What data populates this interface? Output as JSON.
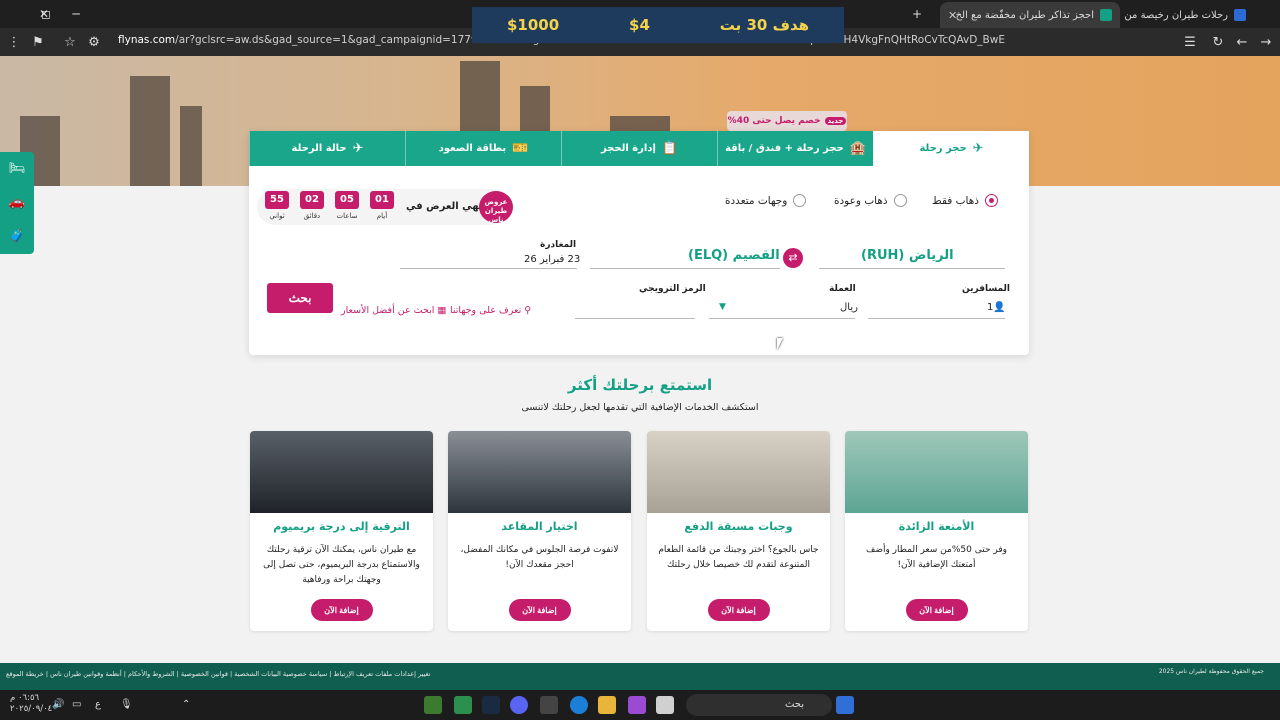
{
  "browser": {
    "tabs": [
      {
        "title": "رحلات طيران رخيصة من الرياض",
        "fav_color": "#2d6bd4",
        "close": "✕"
      },
      {
        "title": "احجز تذاكر طيران مخفّضة مع الخ",
        "fav_color": "#14a085",
        "close": "✕"
      }
    ],
    "new_tab": "+",
    "window_controls": {
      "minimize": "─",
      "maximize": "◻",
      "close": "✕"
    },
    "url_domain": "flynas.com",
    "url_rest": "/ar?gclsrc=aw.ds&gad_source=1&gad_campaignid=17793646925&gbraid=...Woh0XhOeVuPuwC6E2BF7tbGLUWfXRkLMqfGCcsH4VkgFnQHtRoCvTcQAvD_BwE",
    "overlay_ad": {
      "left": "$1000",
      "middle": "$4",
      "right": "هدف 30 بت"
    }
  },
  "promo_badge": {
    "tag": "جديد",
    "text": "خصم يصل حتى 40%"
  },
  "side_tools": [
    "🛏",
    "🚗",
    "🧳"
  ],
  "tabs": [
    {
      "label": "حجز رحلة",
      "icon": "✈"
    },
    {
      "label": "حجز رحلة + فندق / باقة",
      "icon": "🏨"
    },
    {
      "label": "إدارة الحجز",
      "icon": "📋"
    },
    {
      "label": "بطاقة الصعود",
      "icon": "🎫"
    },
    {
      "label": "حالة الرحلة",
      "icon": "✈"
    }
  ],
  "trip_type": {
    "one_way": "ذهاب فقط",
    "round_trip": "ذهاب وعودة",
    "multi_city": "وجهات متعددة"
  },
  "timer": {
    "label": "ينتهي العرض في",
    "badge": "عروض طيران ناس",
    "days": {
      "value": "01",
      "label": "أيام"
    },
    "hours": {
      "value": "05",
      "label": "ساعات"
    },
    "minutes": {
      "value": "02",
      "label": "دقائق"
    },
    "seconds": {
      "value": "55",
      "label": "ثواني"
    }
  },
  "route": {
    "from": "الرياض (RUH)",
    "to": "القصيم (ELQ)",
    "departure_label": "المغادرة",
    "departure_value": "23 فبراير 26",
    "swap_icon": "⇄"
  },
  "passengers": {
    "label": "المسافرين",
    "value": "1"
  },
  "currency": {
    "label": "العملة",
    "value": "ريال"
  },
  "promo_code": {
    "label": "الرمز الترويجي",
    "placeholder": ""
  },
  "search_button": "بحث",
  "links": {
    "best_prices": "ابحث عن أفضل الأسعار",
    "destinations": "تعرف على وجهاتنا"
  },
  "section": {
    "title": "استمتع برحلتك أكثر",
    "subtitle": "استكشف الخدمات الإضافية التي تقدمها لجعل رحلتك لاتنسى"
  },
  "cards": [
    {
      "title": "الأمتعة الزائدة",
      "text": "وفر حتى 50%من سعر المطار وأضف أمتعتك الإضافية الآن!",
      "button": "إضافة الآن",
      "img": "#7fb8a8"
    },
    {
      "title": "وجبات مسبقة الدفع",
      "text": "جاس بالجوع؟ اختر وجبتك من قائمة الطعام المتنوعة لتقدم لك خصيصا خلال رحلتك",
      "button": "إضافة الآن",
      "img": "#c9c3b8"
    },
    {
      "title": "اختيار المقاعد",
      "text": "لاتفوت فرصة الجلوس في مكانك المفضل، احجز مقعدك الآن!",
      "button": "إضافة الآن",
      "img": "#3a4048"
    },
    {
      "title": "الترقية إلى درجة بريميوم",
      "text": "مع طيران ناس، يمكنك الآن ترقية رحلتك والاستمتاع بدرجة البريميوم، حتى تصل إلى وجهتك براحة ورفاهية",
      "button": "إضافة الآن",
      "img": "#2c3138"
    }
  ],
  "footer": {
    "links": "تغيير إعدادات ملفات تعريف الإرتباط | سياسة خصوصية البيانات الشخصية | قوانين الخصوصية | الشروط والأحكام | أنظمة وقوانين طيران ناس | خريطة الموقع",
    "copyright": "جميع الحقوق محفوظة لطيران ناس 2025"
  },
  "taskbar": {
    "search": "بحث",
    "time": "٠٦:٥٦ م",
    "date": "٢٠٢٥/٠٩/٠٤",
    "lang": "ع"
  }
}
